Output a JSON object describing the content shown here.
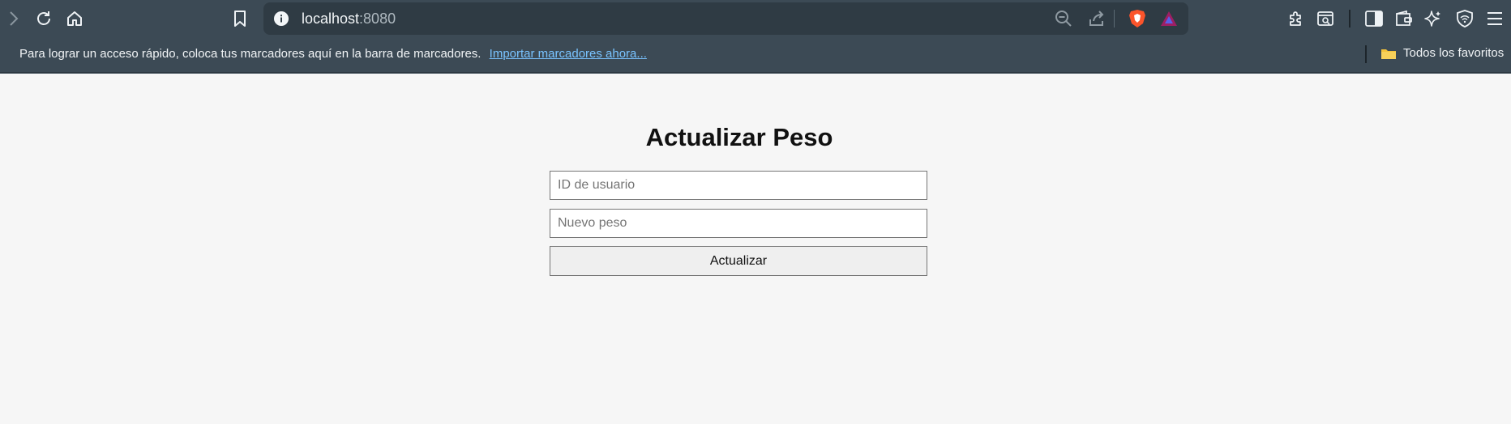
{
  "browser": {
    "address": {
      "host": "localhost",
      "port": ":8080"
    },
    "bookmarks_bar": {
      "message": "Para lograr un acceso rápido, coloca tus marcadores aquí en la barra de marcadores.",
      "import_link": "Importar marcadores ahora...",
      "all_favorites": "Todos los favoritos"
    },
    "icons": [
      "forward-icon",
      "reload-icon",
      "home-icon",
      "bookmark-icon",
      "site-info-icon",
      "zoom-out-icon",
      "share-icon",
      "brave-shields-icon",
      "brave-rewards-icon",
      "extensions-icon",
      "reading-list-icon",
      "sidebar-icon",
      "wallet-icon",
      "leo-ai-icon",
      "vpn-icon",
      "menu-icon",
      "folder-icon"
    ],
    "colors": {
      "chrome": "#3c4a55",
      "address_bar": "#2f3b44",
      "link": "#79c3ff",
      "brave_orange": "#fb542b"
    }
  },
  "page": {
    "title": "Actualizar Peso",
    "form": {
      "user_id_placeholder": "ID de usuario",
      "weight_placeholder": "Nuevo peso",
      "submit_label": "Actualizar"
    }
  }
}
